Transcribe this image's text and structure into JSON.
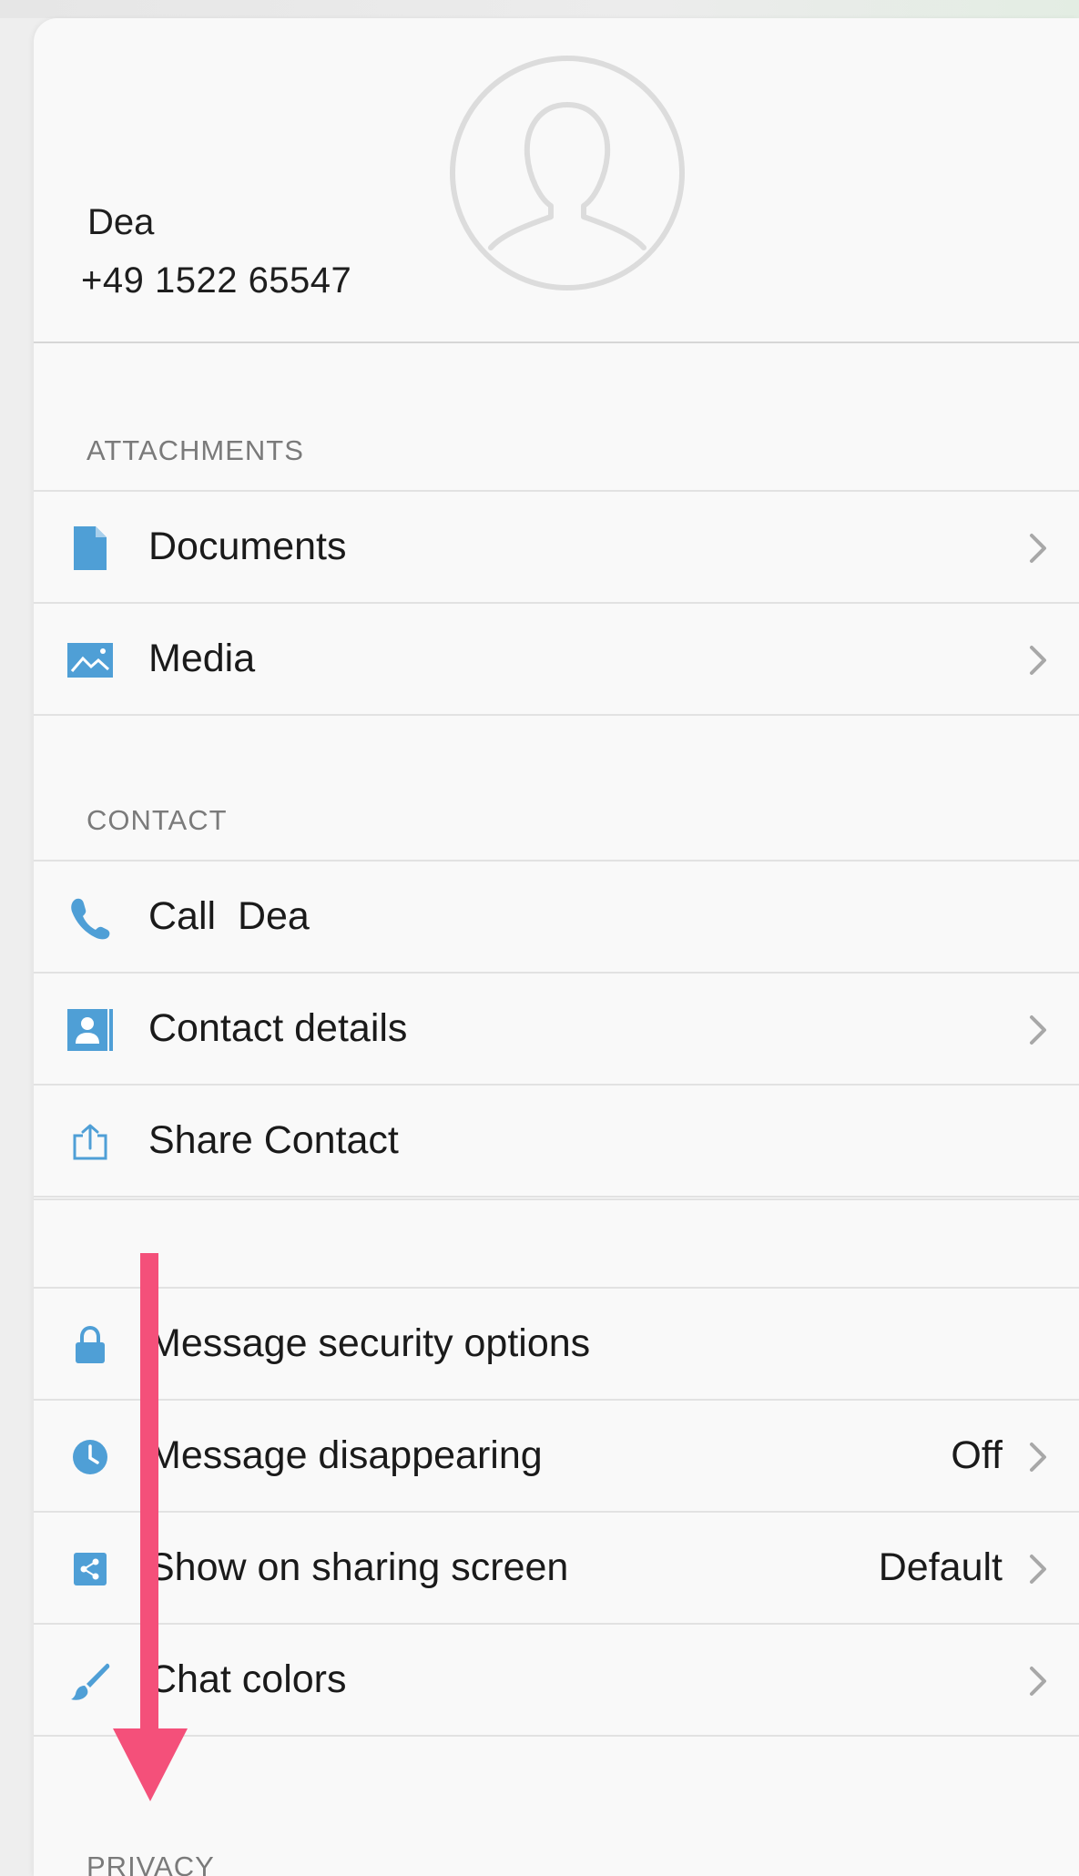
{
  "contact": {
    "name": "Dea",
    "phone": "+49 1522 65547",
    "avatar_icon": "person-silhouette-icon"
  },
  "attachments": {
    "header": "ATTACHMENTS",
    "items": [
      {
        "label": "Documents",
        "icon": "document-icon",
        "chevron": true
      },
      {
        "label": "Media",
        "icon": "image-icon",
        "chevron": true
      }
    ]
  },
  "contact_section": {
    "header": "CONTACT",
    "items": [
      {
        "label": "Call  Dea",
        "icon": "phone-icon",
        "chevron": false
      },
      {
        "label": "Contact details",
        "icon": "contact-card-icon",
        "chevron": true
      },
      {
        "label": "Share Contact",
        "icon": "share-icon",
        "chevron": false
      }
    ]
  },
  "settings": {
    "items": [
      {
        "label": "Message security options",
        "icon": "lock-icon",
        "chevron": false
      },
      {
        "label": "Message disappearing",
        "value": "Off",
        "icon": "clock-icon",
        "chevron": true
      },
      {
        "label": "Show on sharing screen",
        "value": "Default",
        "icon": "sharing-screen-icon",
        "chevron": true
      },
      {
        "label": "Chat colors",
        "icon": "paintbrush-icon",
        "chevron": true
      }
    ]
  },
  "privacy": {
    "header": "PRIVACY"
  },
  "colors": {
    "accent_icon": "#4f9fd6",
    "annotation_arrow": "#f4507a"
  }
}
